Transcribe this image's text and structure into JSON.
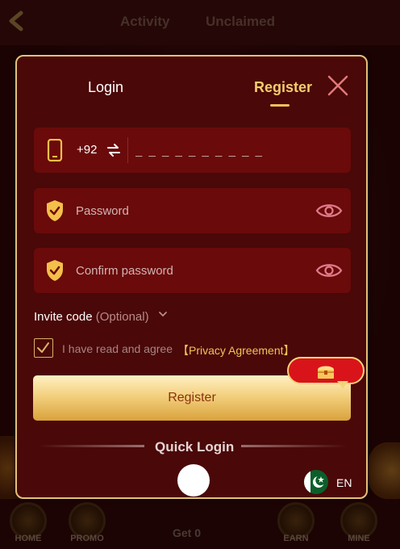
{
  "background": {
    "tabs": [
      "Activity",
      "Unclaimed"
    ],
    "nav": {
      "home": "HOME",
      "promo": "PROMO",
      "get": "Get 0",
      "earn": "EARN",
      "mine": "MINE"
    }
  },
  "modal": {
    "tabs": {
      "login": "Login",
      "register": "Register",
      "active": "Register"
    },
    "phone": {
      "country_code": "+92",
      "placeholder": "_ _ _ _ _ _ _ _ _ _",
      "value": ""
    },
    "password": {
      "placeholder": "Password",
      "value": ""
    },
    "confirm_password": {
      "placeholder": "Confirm password",
      "value": ""
    },
    "invite": {
      "label": "Invite code",
      "optional": "(Optional)"
    },
    "agreement": {
      "text": "I have read and agree",
      "link": "【Privacy Agreement】",
      "checked": true
    },
    "register_button": "Register",
    "quick_login": "Quick Login",
    "language": {
      "code": "EN",
      "flag": "pakistan-flag"
    }
  },
  "colors": {
    "modal_bg": "#4a0808",
    "field_bg": "#6a0a0a",
    "gold": "#f3cc6e",
    "accent_red": "#d8141a"
  }
}
